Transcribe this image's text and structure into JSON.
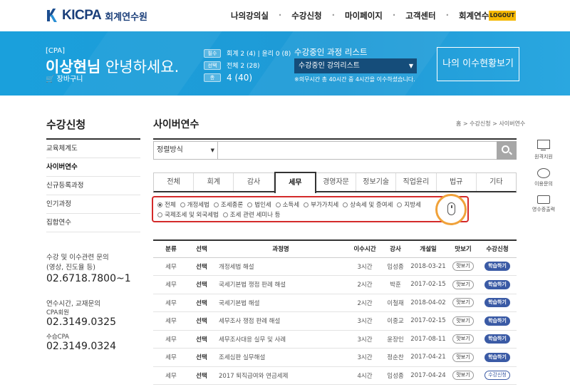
{
  "header": {
    "logo_text": "KICPA",
    "logo_sub": "회계연수원",
    "nav": [
      "나의강의실",
      "수강신청",
      "마이페이지",
      "고객센터",
      "회계연수원"
    ],
    "logout": "LOGOUT"
  },
  "banner": {
    "tag": "[CPA]",
    "name": "이상현님",
    "greeting": "안녕하세요.",
    "cart": "장바구니",
    "stats": [
      {
        "badge": "필수",
        "text": "회계 2 (4) | 윤리 0 (8)"
      },
      {
        "badge": "선택",
        "text": "전체 2 (28)"
      },
      {
        "badge": "총",
        "text": "4 (40)"
      }
    ],
    "list_title": "수강중인 과정 리스트",
    "list_select": "수강중인 강의리스트",
    "list_note": "※의무시간 총 40시간 중 4시간을 이수하셨습니다.",
    "status_button": "나의 이수현황보기"
  },
  "sidebar": {
    "title": "수강신청",
    "items": [
      {
        "label": "교육체계도",
        "active": false
      },
      {
        "label": "사이버연수",
        "active": true
      },
      {
        "label": "신규등록과정",
        "active": false
      },
      {
        "label": "인기과정",
        "active": false
      },
      {
        "label": "집합연수",
        "active": false
      }
    ],
    "contact1_label": "수강 및 이수관련 문의\n(영상, 진도율 등)",
    "contact1_label_l1": "수강 및 이수관련 문의",
    "contact1_label_l2": "(영상, 진도율 등)",
    "contact1_num": "02.6718.7800~1",
    "contact2_label": "연수시간, 교재문의",
    "contact2_sub1": "CPA회원",
    "contact2_num1": "02.3149.0325",
    "contact2_sub2": "수습CPA",
    "contact2_num2": "02.3149.0324"
  },
  "main": {
    "title": "사이버연수",
    "breadcrumb": "홈 > 수강신청 > 사이버연수",
    "sort_label": "정렬방식",
    "tabs": [
      {
        "label": "전체",
        "active": false
      },
      {
        "label": "회계",
        "active": false
      },
      {
        "label": "감사",
        "active": false
      },
      {
        "label": "세무",
        "active": true
      },
      {
        "label": "경영자문",
        "active": false
      },
      {
        "label": "정보기술",
        "active": false
      },
      {
        "label": "직업윤리",
        "active": false
      },
      {
        "label": "법규",
        "active": false
      },
      {
        "label": "기타",
        "active": false
      }
    ],
    "filters": [
      {
        "label": "전체",
        "on": true
      },
      {
        "label": "개정세법",
        "on": false
      },
      {
        "label": "조세종론",
        "on": false
      },
      {
        "label": "법인세",
        "on": false
      },
      {
        "label": "소득세",
        "on": false
      },
      {
        "label": "부가가치세",
        "on": false
      },
      {
        "label": "상속세 및 증여세",
        "on": false
      },
      {
        "label": "지방세",
        "on": false
      },
      {
        "label": "국제조세 및 외국세법",
        "on": false
      },
      {
        "label": "조세 관련 세미나 등",
        "on": false
      }
    ],
    "table": {
      "headers": [
        "분류",
        "선택",
        "과정명",
        "이수시간",
        "강사",
        "개설일",
        "맛보기",
        "수강신청"
      ],
      "rows": [
        {
          "cat": "세무",
          "sel": "선택",
          "title": "개정세법 해설",
          "hours": "3시간",
          "lecturer": "임성종",
          "date": "2018-03-21",
          "preview": "맛보기",
          "action": "학습하기",
          "alt": false
        },
        {
          "cat": "세무",
          "sel": "선택",
          "title": "국세기본법 쟁점 판례 해설",
          "hours": "2시간",
          "lecturer": "박훈",
          "date": "2017-02-15",
          "preview": "맛보기",
          "action": "학습하기",
          "alt": false
        },
        {
          "cat": "세무",
          "sel": "선택",
          "title": "국세기본법 해설",
          "hours": "2시간",
          "lecturer": "이철재",
          "date": "2018-04-02",
          "preview": "맛보기",
          "action": "학습하기",
          "alt": false
        },
        {
          "cat": "세무",
          "sel": "선택",
          "title": "세무조사 쟁점 판례 해설",
          "hours": "3시간",
          "lecturer": "이중교",
          "date": "2017-02-15",
          "preview": "맛보기",
          "action": "학습하기",
          "alt": false
        },
        {
          "cat": "세무",
          "sel": "선택",
          "title": "세무조사대응 실무 및 사례",
          "hours": "3시간",
          "lecturer": "윤장인",
          "date": "2017-08-11",
          "preview": "맛보기",
          "action": "학습하기",
          "alt": false
        },
        {
          "cat": "세무",
          "sel": "선택",
          "title": "조세심판 실무해설",
          "hours": "3시간",
          "lecturer": "정순찬",
          "date": "2017-04-21",
          "preview": "맛보기",
          "action": "학습하기",
          "alt": false
        },
        {
          "cat": "세무",
          "sel": "선택",
          "title": "2017 퇴직급여와 연금세제",
          "hours": "4시간",
          "lecturer": "임성종",
          "date": "2017-04-24",
          "preview": "맛보기",
          "action": "수강신청",
          "alt": true
        }
      ]
    }
  },
  "quick": {
    "items": [
      "원격지원",
      "이용문의",
      "영수증출력"
    ]
  }
}
